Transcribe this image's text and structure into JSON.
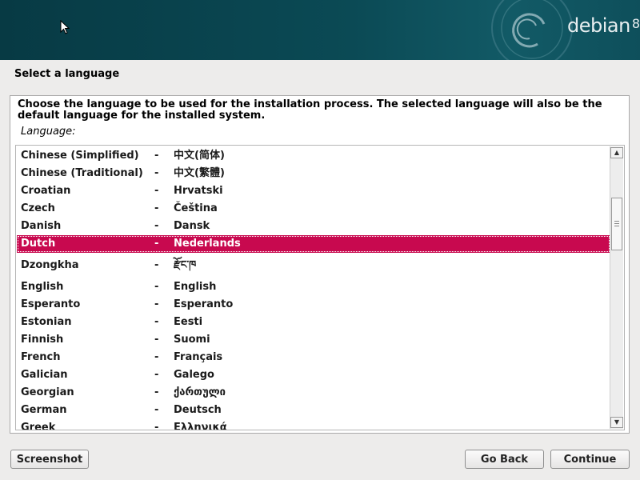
{
  "banner": {
    "brand": "debian",
    "version": "8"
  },
  "page": {
    "title": "Select a language",
    "description": "Choose the language to be used for the installation process. The selected language will also be the default language for the installed system.",
    "list_label": "Language:"
  },
  "languages": [
    {
      "name": "Chinese (Simplified)",
      "sep": "-",
      "native": "中文(简体)"
    },
    {
      "name": "Chinese (Traditional)",
      "sep": "-",
      "native": "中文(繁體)"
    },
    {
      "name": "Croatian",
      "sep": "-",
      "native": "Hrvatski"
    },
    {
      "name": "Czech",
      "sep": "-",
      "native": "Čeština"
    },
    {
      "name": "Danish",
      "sep": "-",
      "native": "Dansk"
    },
    {
      "name": "Dutch",
      "sep": "-",
      "native": "Nederlands"
    },
    {
      "name": "Dzongkha",
      "sep": "-",
      "native": "རྫོང་ཁ"
    },
    {
      "name": "English",
      "sep": "-",
      "native": "English"
    },
    {
      "name": "Esperanto",
      "sep": "-",
      "native": "Esperanto"
    },
    {
      "name": "Estonian",
      "sep": "-",
      "native": "Eesti"
    },
    {
      "name": "Finnish",
      "sep": "-",
      "native": "Suomi"
    },
    {
      "name": "French",
      "sep": "-",
      "native": "Français"
    },
    {
      "name": "Galician",
      "sep": "-",
      "native": "Galego"
    },
    {
      "name": "Georgian",
      "sep": "-",
      "native": "ქართული"
    },
    {
      "name": "German",
      "sep": "-",
      "native": "Deutsch"
    },
    {
      "name": "Greek",
      "sep": "-",
      "native": "Ελληνικά"
    }
  ],
  "selected_language": "Dutch",
  "buttons": {
    "screenshot": "Screenshot",
    "go_back": "Go Back",
    "continue": "Continue"
  },
  "colors": {
    "selection": "#c8094f",
    "banner": "#0b4a55"
  },
  "icons": {
    "scroll_up": "▲",
    "scroll_down": "▼"
  }
}
